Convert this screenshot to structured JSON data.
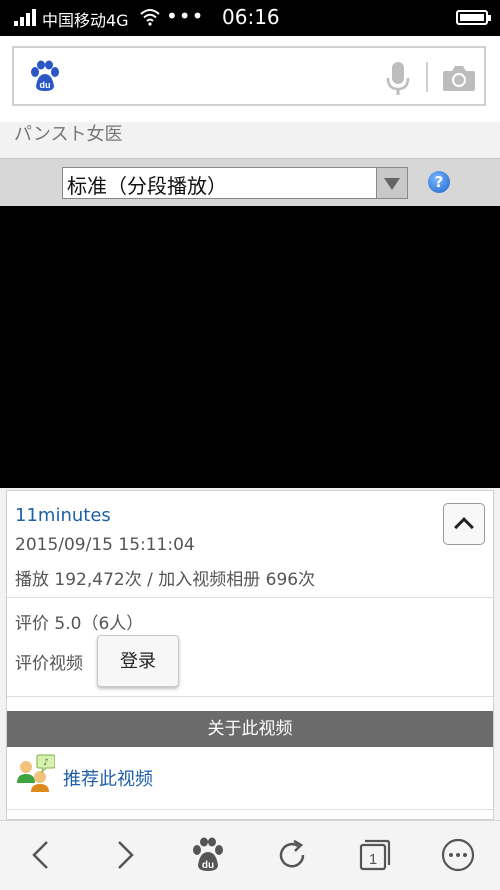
{
  "status_bar": {
    "carrier": "中国移动4G",
    "dots": "•••",
    "time": "06:16"
  },
  "search": {
    "logo_text": "du"
  },
  "page": {
    "heading": "パンスト女医"
  },
  "player": {
    "quality_option": "标准（分段播放）",
    "help_symbol": "?"
  },
  "video": {
    "title": "11minutes",
    "date": "2015/09/15 15:11:04",
    "stats": "播放 192,472次 / 加入视频相册 696次",
    "rating": "评价 5.0（6人）",
    "rate_label": "评价视频",
    "login_label": "登录"
  },
  "about": {
    "header": "关于此视频",
    "recommend_label": "推荐此视频"
  },
  "toolbar": {
    "tabs_count": "1",
    "logo_text": "du"
  },
  "icons": {
    "paw": "baidu-paw-icon",
    "mic": "microphone-icon",
    "camera": "camera-icon",
    "back": "chevron-left-icon",
    "forward": "chevron-right-icon",
    "refresh": "refresh-icon",
    "tabs": "tabs-icon",
    "menu": "more-icon"
  },
  "colors": {
    "link": "#1f5fa8",
    "baidu_blue": "#2a56c6"
  }
}
